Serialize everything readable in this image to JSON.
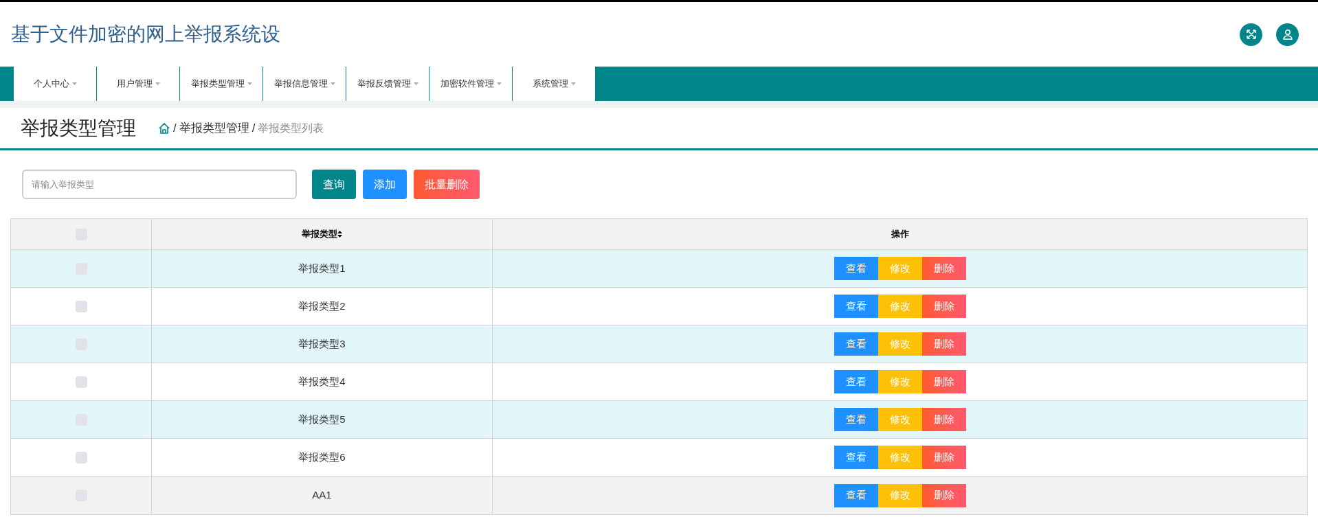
{
  "header": {
    "title": "基于文件加密的网上举报系统设"
  },
  "nav": [
    {
      "label": "个人中心"
    },
    {
      "label": "用户管理"
    },
    {
      "label": "举报类型管理"
    },
    {
      "label": "举报信息管理"
    },
    {
      "label": "举报反馈管理"
    },
    {
      "label": "加密软件管理"
    },
    {
      "label": "系统管理"
    }
  ],
  "page": {
    "title": "举报类型管理",
    "breadcrumb": [
      "举报类型管理",
      "举报类型列表"
    ],
    "separator": "/"
  },
  "search": {
    "placeholder": "请输入举报类型"
  },
  "toolbar": [
    {
      "label": "查询",
      "kind": "query"
    },
    {
      "label": "添加",
      "kind": "add"
    },
    {
      "label": "批量删除",
      "kind": "batch-delete"
    }
  ],
  "table": {
    "select_all": {
      "checked": false
    },
    "columns": [
      "举报类型",
      "操作"
    ],
    "rows": [
      {
        "type": "举报类型1",
        "checked": false,
        "hovered": false,
        "actions": [
          "查看",
          "修改",
          "删除"
        ]
      },
      {
        "type": "举报类型2",
        "checked": false,
        "hovered": false,
        "actions": [
          "查看",
          "修改",
          "删除"
        ]
      },
      {
        "type": "举报类型3",
        "checked": false,
        "hovered": false,
        "actions": [
          "查看",
          "修改",
          "删除"
        ]
      },
      {
        "type": "举报类型4",
        "checked": false,
        "hovered": false,
        "actions": [
          "查看",
          "修改",
          "删除"
        ]
      },
      {
        "type": "举报类型5",
        "checked": false,
        "hovered": false,
        "actions": [
          "查看",
          "修改",
          "删除"
        ]
      },
      {
        "type": "举报类型6",
        "checked": false,
        "hovered": false,
        "actions": [
          "查看",
          "修改",
          "删除"
        ]
      },
      {
        "type": "AA1",
        "checked": false,
        "hovered": true,
        "actions": [
          "查看",
          "修改",
          "删除"
        ]
      }
    ]
  }
}
